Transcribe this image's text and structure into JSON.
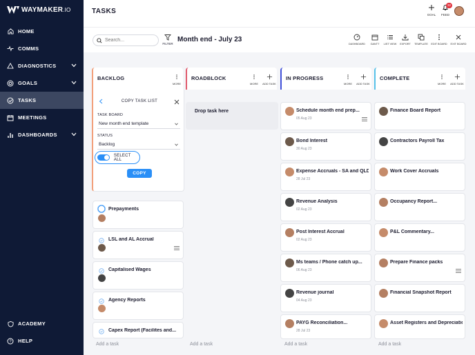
{
  "app": {
    "brand": "WAYMAKER",
    "brand_suffix": ".IO",
    "page_title": "TASKS"
  },
  "sidebar": {
    "items": [
      {
        "label": "HOME",
        "icon": "home-icon"
      },
      {
        "label": "COMMS",
        "icon": "pulse-icon"
      },
      {
        "label": "DIAGNOSTICS",
        "icon": "triangle-icon",
        "expandable": true
      },
      {
        "label": "GOALS",
        "icon": "target-icon",
        "expandable": true
      },
      {
        "label": "TASKS",
        "icon": "check-circle-icon",
        "active": true
      },
      {
        "label": "MEETINGS",
        "icon": "calendar-icon"
      },
      {
        "label": "DASHBOARDS",
        "icon": "bar-chart-icon",
        "expandable": true
      }
    ],
    "bottom": [
      {
        "label": "ACADEMY",
        "icon": "shield-icon"
      },
      {
        "label": "HELP",
        "icon": "help-icon"
      }
    ]
  },
  "header": {
    "goal_label": "GOAL",
    "feed_label": "FEED",
    "feed_count": "32"
  },
  "toolbar": {
    "search_placeholder": "Search...",
    "filter_label": "FILTER",
    "board_title": "Month end - July 23",
    "actions": [
      "DASHBOARD",
      "GANTT",
      "LIST VIEW",
      "EXPORT",
      "TEMPLATE",
      "EDIT BOARD",
      "EXIT BOARD"
    ]
  },
  "columns": {
    "backlog": {
      "title": "BACKLOG",
      "more": "MORE",
      "accent": "#f2a07b"
    },
    "roadblock": {
      "title": "ROADBLOCK",
      "more": "MORE",
      "add": "ADD TASK",
      "accent": "#e05a6d"
    },
    "in_progress": {
      "title": "IN PROGRESS",
      "more": "MORE",
      "add": "ADD TASK",
      "accent": "#3f4fd8"
    },
    "complete": {
      "title": "COMPLETE",
      "more": "MORE",
      "add": "ADD TASK",
      "accent": "#56c1e8"
    }
  },
  "copy_panel": {
    "title": "COPY TASK LIST",
    "board_label": "TASK BOARD",
    "board_value": "New month end template",
    "status_label": "STATUS",
    "status_value": "Backlog",
    "select_all_label": "SELECT ALL",
    "copy_label": "COPY"
  },
  "backlog_cards": [
    {
      "title": "Prepayments"
    },
    {
      "title": "LSL and AL Accrual"
    },
    {
      "title": "Capitalised Wages"
    },
    {
      "title": "Agency Reports"
    },
    {
      "title": "Capex Report (Facilites and..."
    }
  ],
  "roadblock": {
    "drop_text": "Drop task here"
  },
  "progress_cards": [
    {
      "title": "Schedule month end prep...",
      "date": "05 Aug 23"
    },
    {
      "title": "Bond Interest",
      "date": "30 Aug 23"
    },
    {
      "title": "Expense Accruals - SA and QLD",
      "date": "28 Jul 23"
    },
    {
      "title": "Revenue Analysis",
      "date": "02 Aug 23"
    },
    {
      "title": "Post Interest Accrual",
      "date": "02 Aug 23"
    },
    {
      "title": "Ms teams / Phone catch up...",
      "date": "06 Aug 23"
    },
    {
      "title": "Revenue journal",
      "date": "04 Aug 23"
    },
    {
      "title": "PAYG Reconciliation...",
      "date": "28 Jul 23"
    }
  ],
  "complete_cards": [
    {
      "title": "Finance Board Report"
    },
    {
      "title": "Contractors Payroll Tax"
    },
    {
      "title": "Work Cover Accruals"
    },
    {
      "title": "Occupancy Report..."
    },
    {
      "title": "P&L Commentary..."
    },
    {
      "title": "Prepare Finance packs"
    },
    {
      "title": "Financial Snapshot Report"
    },
    {
      "title": "Asset Registers and Depreciation"
    }
  ],
  "add_task_label": "Add a task"
}
